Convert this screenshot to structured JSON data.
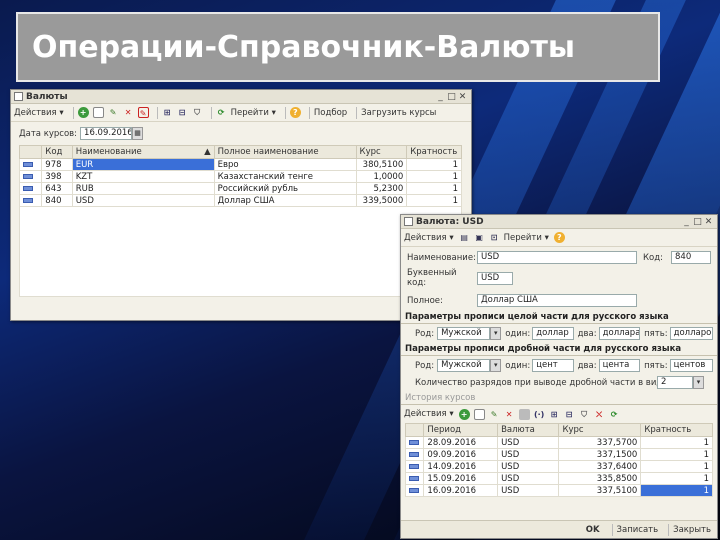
{
  "slide_title": "Операции-Справочник-Валюты",
  "list_window": {
    "title": "Валюты",
    "toolbar": {
      "actions": "Действия",
      "goto": "Перейти",
      "selection": "Подбор",
      "load_rates": "Загрузить курсы"
    },
    "date_label": "Дата курсов:",
    "date_value": "16.09.2016",
    "columns": [
      "Код",
      "Наименование",
      "Полное наименование",
      "Курс",
      "Кратность"
    ],
    "rows": [
      {
        "code": "978",
        "name": "EUR",
        "full": "Евро",
        "rate": "380,5100",
        "mult": "1"
      },
      {
        "code": "398",
        "name": "KZT",
        "full": "Казахстанский тенге",
        "rate": "1,0000",
        "mult": "1"
      },
      {
        "code": "643",
        "name": "RUB",
        "full": "Российский рубль",
        "rate": "5,2300",
        "mult": "1"
      },
      {
        "code": "840",
        "name": "USD",
        "full": "Доллар США",
        "rate": "339,5000",
        "mult": "1"
      }
    ]
  },
  "detail_window": {
    "title": "Валюта: USD",
    "toolbar": {
      "actions": "Действия",
      "goto": "Перейти"
    },
    "name_label": "Наименование:",
    "name_value": "USD",
    "code_label": "Код:",
    "code_value": "840",
    "digit_label": "Буквенный код:",
    "digit_value": "USD",
    "full_label": "Полное:",
    "full_value": "Доллар США",
    "whole_section": "Параметры прописи целой части для русского языка",
    "frac_section": "Параметры прописи дробной части для русского языка",
    "whole": {
      "gender_label": "Род:",
      "gender": "Мужской",
      "one_label": "один:",
      "one": "доллар",
      "two_label": "два:",
      "two": "доллара",
      "five_label": "пять:",
      "five": "долларов"
    },
    "frac": {
      "gender_label": "Род:",
      "gender": "Мужской",
      "one_label": "один:",
      "one": "цент",
      "two_label": "два:",
      "two": "цента",
      "five_label": "пять:",
      "five": "центов"
    },
    "frac_digits_label": "Количество разрядов при выводе дробной части в виде числа:",
    "frac_digits_value": "2",
    "history_section": "История курсов",
    "history_actions": "Действия",
    "history_columns": [
      "Период",
      "Валюта",
      "Курс",
      "Кратность"
    ],
    "history_rows": [
      {
        "period": "28.09.2016",
        "cur": "USD",
        "rate": "337,5700",
        "mult": "1"
      },
      {
        "period": "09.09.2016",
        "cur": "USD",
        "rate": "337,1500",
        "mult": "1"
      },
      {
        "period": "14.09.2016",
        "cur": "USD",
        "rate": "337,6400",
        "mult": "1"
      },
      {
        "period": "15.09.2016",
        "cur": "USD",
        "rate": "335,8500",
        "mult": "1"
      },
      {
        "period": "16.09.2016",
        "cur": "USD",
        "rate": "337,5100",
        "mult": "1"
      }
    ],
    "footer": {
      "ok": "OK",
      "save": "Записать",
      "close": "Закрыть"
    }
  }
}
